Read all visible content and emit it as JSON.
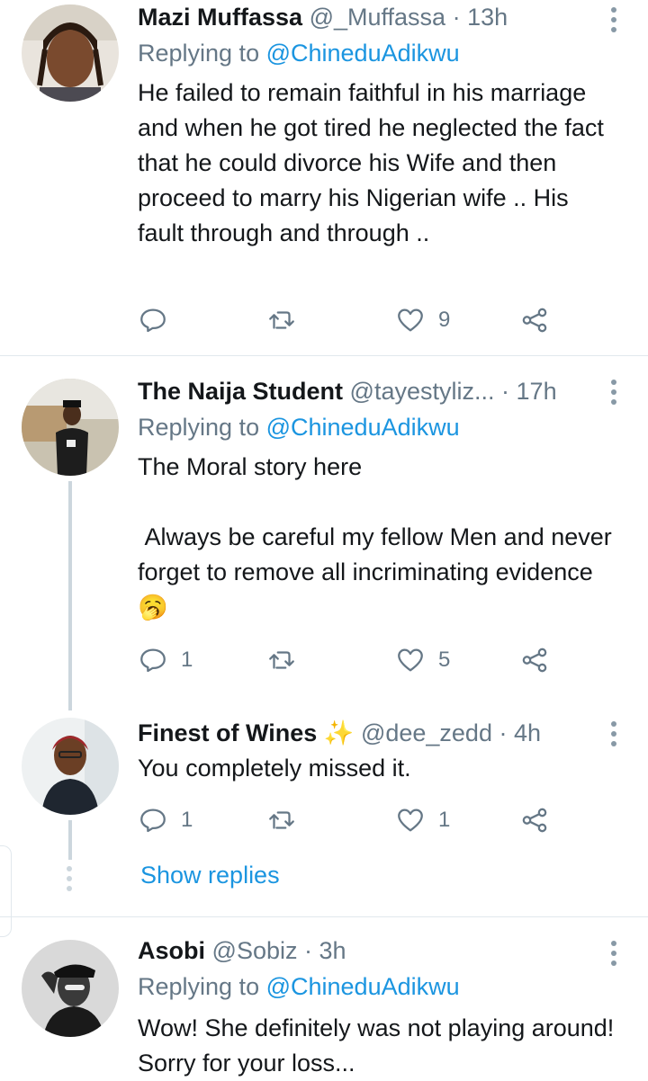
{
  "tweets": [
    {
      "name": "Mazi Muffassa",
      "handle": "@_Muffassa",
      "time": "13h",
      "replying_prefix": "Replying to ",
      "replying_to": "@ChineduAdikwu",
      "text": "He failed to remain faithful in his marriage and when he got tired he neglected the fact that he could divorce his Wife and then proceed to marry his Nigerian wife .. His fault through and through ..",
      "replies": "",
      "retweets": "",
      "likes": "9"
    },
    {
      "name": "The Naija Student",
      "handle": "@tayestyliz...",
      "time": "17h",
      "replying_prefix": "Replying to ",
      "replying_to": "@ChineduAdikwu",
      "text": "The Moral story here\n\n Always be careful my fellow Men and never forget to remove all incriminating evidence 🥱",
      "replies": "1",
      "retweets": "",
      "likes": "5"
    },
    {
      "name": "Finest of Wines",
      "name_emoji": "✨",
      "handle": "@dee_zedd",
      "time": "4h",
      "text": "You completely missed it.",
      "replies": "1",
      "retweets": "",
      "likes": "1"
    },
    {
      "name": "Asobi",
      "handle": "@Sobiz",
      "time": "3h",
      "replying_prefix": "Replying to ",
      "replying_to": "@ChineduAdikwu",
      "text": "Wow! She definitely was not playing around! Sorry for your loss..."
    }
  ],
  "show_replies": "Show replies",
  "dot": "·",
  "colors": {
    "link": "#1b95e0",
    "secondary": "#657786",
    "divider": "#e1e8ed"
  },
  "icons": [
    "reply-icon",
    "retweet-icon",
    "like-icon",
    "share-icon",
    "more-options-icon"
  ]
}
